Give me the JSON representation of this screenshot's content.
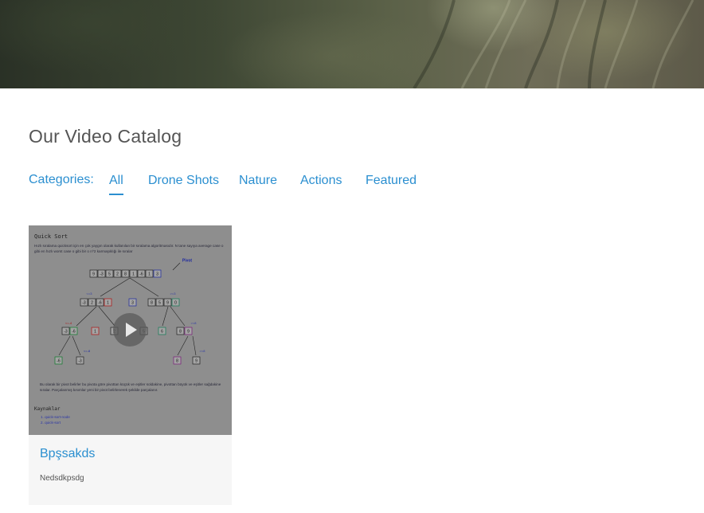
{
  "catalog": {
    "title": "Our Video Catalog",
    "categories_label": "Categories:",
    "categories": [
      "All",
      "Drone Shots",
      "Nature",
      "Actions",
      "Featured"
    ],
    "active_category": "All"
  },
  "videos": [
    {
      "title": "Bpşsakds",
      "description": "Nedsdkpsdg",
      "thumbnail": {
        "heading": "Quick Sort",
        "intro": "Hızlı sıralama quicksort için en çok yaygın olarak kullanılan bir sıralama algoritmasıdır. N tane sayıya average case o gibi en hızlı worst case o gibi bir o n^2 karmaşıklığı ile sıralar",
        "pivot_label": "Pivot",
        "labels": {
          "le": "<=3",
          "ge": "<=3",
          "ge2": ">=3",
          "ge3": ">=8",
          "le3": "<=-4",
          "gt": "<=-8",
          "ge4": ">=8"
        },
        "bullet": "Bu olarak bir pivot belirler bu pivota göre pivottan küçük ve eşitler soldakine, pivottan büyük ve eşitler sağdakine sıralar. Parçalanmış kısımlar yeni bir pivot belirlenerek şekilde parçalanır.",
        "refs_heading": "Kaynaklar",
        "refs": [
          "1. quick-sort-node",
          "2. quick-sort"
        ],
        "row1": [
          "9",
          "-3",
          "5",
          "2",
          "8",
          "1",
          "-6",
          "1",
          "3"
        ],
        "row2_left": [
          "-3",
          "2",
          "-6",
          "1"
        ],
        "row2_mid": [
          "3"
        ],
        "row2_right": [
          "8",
          "5",
          "9",
          "0"
        ],
        "row3": [
          "-3",
          "-6",
          "1",
          "2",
          "5",
          "6",
          "8",
          "9"
        ],
        "row4": [
          "-6",
          "-3",
          "8",
          "9"
        ]
      }
    }
  ],
  "colors": {
    "accent": "#2b8fd0",
    "title_gray": "#555555",
    "card_bg": "#f6f6f6"
  },
  "icons": {
    "play": "play-icon"
  }
}
